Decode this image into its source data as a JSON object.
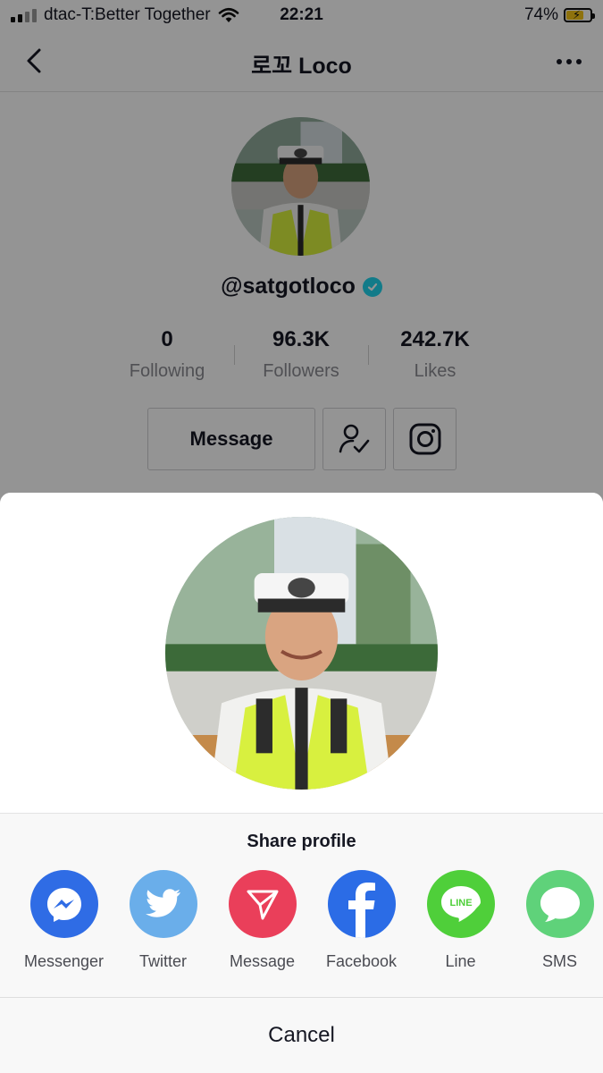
{
  "status_bar": {
    "carrier": "dtac-T:Better Together",
    "time": "22:21",
    "battery_percent": "74%",
    "battery_level": 0.74,
    "signal_icon": "cellular-signal-icon",
    "wifi_icon": "wifi-icon"
  },
  "nav": {
    "title": "로꼬 Loco",
    "back_icon": "chevron-left-icon",
    "more_icon": "more-horizontal-icon"
  },
  "profile": {
    "username": "@satgotloco",
    "verified_icon": "verified-check-icon",
    "stats": [
      {
        "value": "0",
        "label": "Following"
      },
      {
        "value": "96.3K",
        "label": "Followers"
      },
      {
        "value": "242.7K",
        "label": "Likes"
      }
    ],
    "message_button": "Message",
    "follow_icon": "user-check-icon",
    "instagram_icon": "instagram-icon"
  },
  "share_sheet": {
    "title": "Share profile",
    "targets": [
      {
        "label": "Messenger",
        "icon": "messenger-icon",
        "color": "#2f6ce5"
      },
      {
        "label": "Twitter",
        "icon": "twitter-bird-icon",
        "color": "#6aaeea"
      },
      {
        "label": "Message",
        "icon": "send-icon",
        "color": "#ea3f5a"
      },
      {
        "label": "Facebook",
        "icon": "facebook-icon",
        "color": "#2b6ce6"
      },
      {
        "label": "Line",
        "icon": "line-icon",
        "color": "#4fcf3a"
      },
      {
        "label": "SMS",
        "icon": "chat-bubble-icon",
        "color": "#5fd27a"
      }
    ],
    "cancel": "Cancel"
  },
  "colors": {
    "text": "#161823",
    "muted": "#8a8b91",
    "verified": "#20d5ec",
    "overlay": "rgba(0,0,0,0.42)"
  }
}
